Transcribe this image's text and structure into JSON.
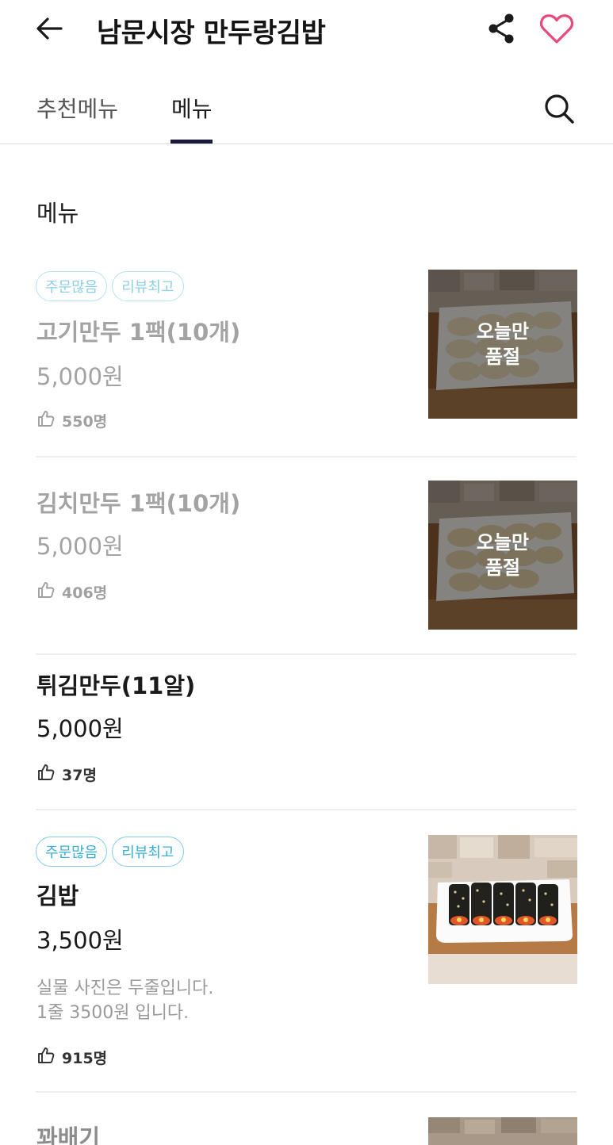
{
  "header": {
    "title": "남문시장 만두랑김밥",
    "back_icon": "arrow-left-icon",
    "share_icon": "share-icon",
    "favorite_icon": "heart-outline-icon",
    "favorite_color": "#e8497a"
  },
  "tabs": [
    {
      "label": "추천메뉴",
      "active": false
    },
    {
      "label": "메뉴",
      "active": true
    }
  ],
  "search_icon": "search-icon",
  "section_title": "메뉴",
  "items": [
    {
      "badges": [
        "주문많음",
        "리뷰최고"
      ],
      "name": "고기만두 1팩(10개)",
      "price": "5,000원",
      "likes": "550명",
      "sold_out": true,
      "overlay": "오늘만\n품절"
    },
    {
      "name": "김치만두 1팩(10개)",
      "price": "5,000원",
      "likes": "406명",
      "sold_out": true,
      "overlay": "오늘만\n품절"
    },
    {
      "name": "튀김만두(11알)",
      "price": "5,000원",
      "likes": "37명",
      "sold_out": false
    },
    {
      "badges": [
        "주문많음",
        "리뷰최고"
      ],
      "name": "김밥",
      "price": "3,500원",
      "description": [
        "실물 사진은 두줄입니다.",
        "1줄 3500원 입니다."
      ],
      "likes": "915명",
      "sold_out": false
    },
    {
      "name": "꽈배기"
    }
  ],
  "colors": {
    "badge": "#3aaed6",
    "tab_indicator": "#1b1a3a"
  }
}
